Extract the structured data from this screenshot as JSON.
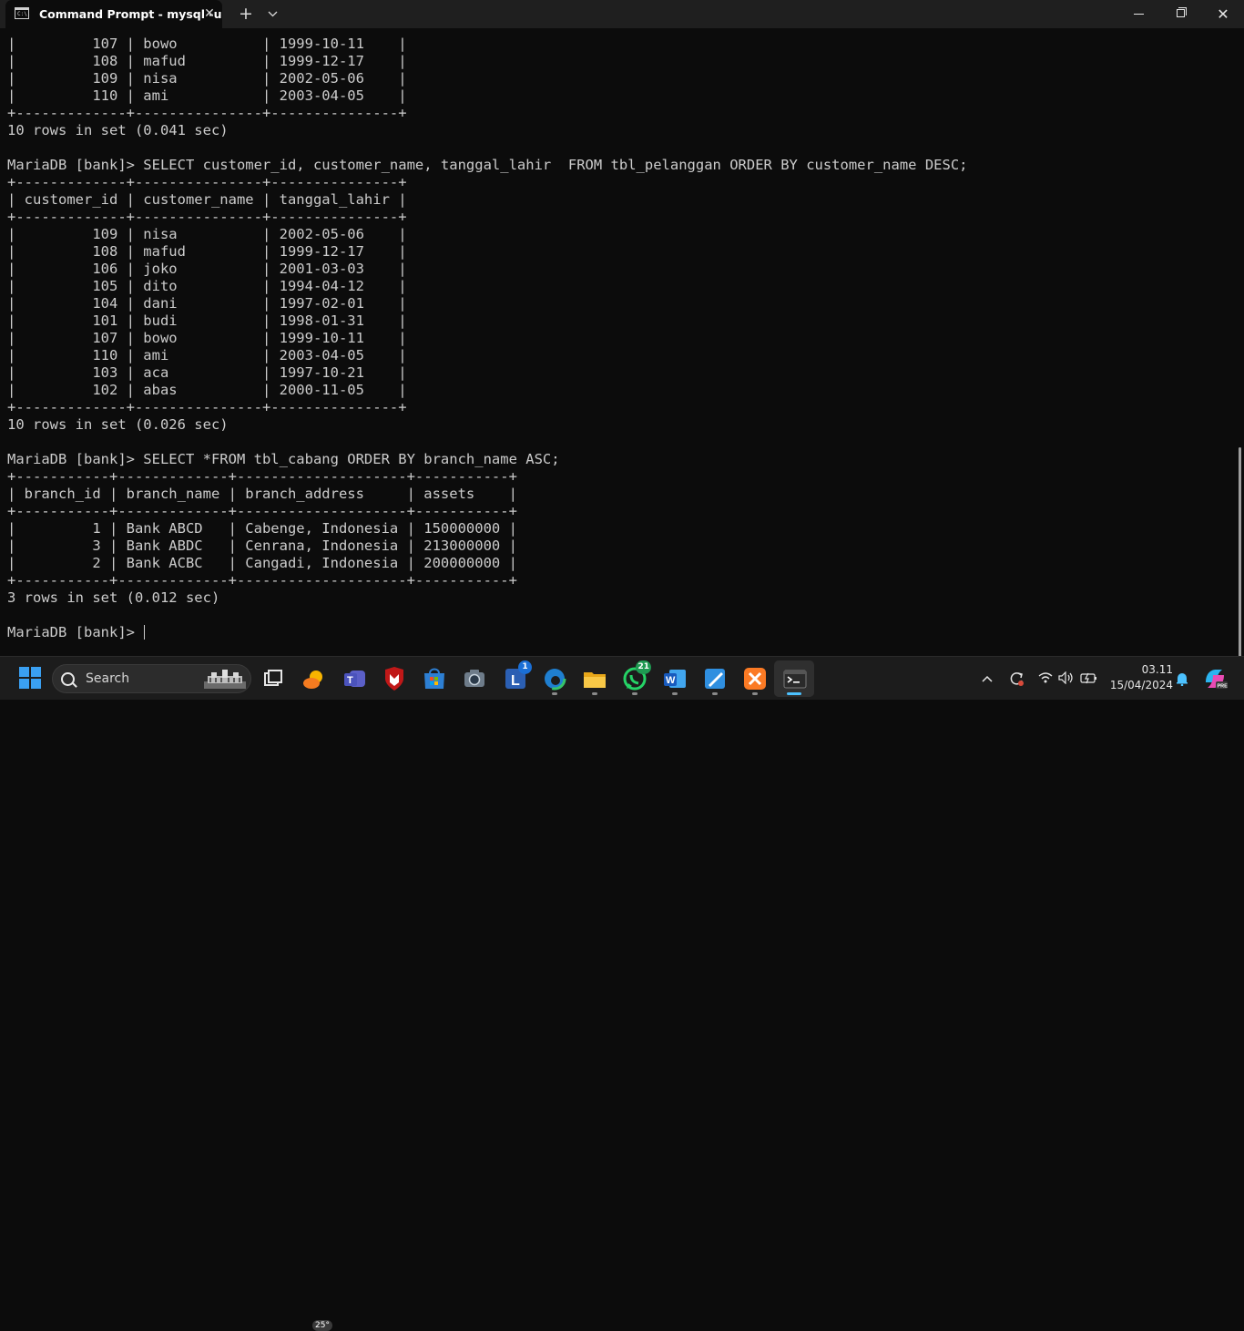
{
  "window": {
    "tab_title": "Command Prompt - mysql  -u",
    "tab_icon_text": "C:\\.",
    "close_tab_label": "✕",
    "new_tab_label": "+",
    "dropdown_label": "⌄",
    "minimize_label": "",
    "maximize_label": "",
    "close_label": "✕"
  },
  "console": {
    "lines": [
      "|         107 | bowo          | 1999-10-11    |",
      "|         108 | mafud         | 1999-12-17    |",
      "|         109 | nisa          | 2002-05-06    |",
      "|         110 | ami           | 2003-04-05    |",
      "+-------------+---------------+---------------+",
      "10 rows in set (0.041 sec)",
      "",
      "MariaDB [bank]> SELECT customer_id, customer_name, tanggal_lahir  FROM tbl_pelanggan ORDER BY customer_name DESC;",
      "+-------------+---------------+---------------+",
      "| customer_id | customer_name | tanggal_lahir |",
      "+-------------+---------------+---------------+",
      "|         109 | nisa          | 2002-05-06    |",
      "|         108 | mafud         | 1999-12-17    |",
      "|         106 | joko          | 2001-03-03    |",
      "|         105 | dito          | 1994-04-12    |",
      "|         104 | dani          | 1997-02-01    |",
      "|         101 | budi          | 1998-01-31    |",
      "|         107 | bowo          | 1999-10-11    |",
      "|         110 | ami           | 2003-04-05    |",
      "|         103 | aca           | 1997-10-21    |",
      "|         102 | abas          | 2000-11-05    |",
      "+-------------+---------------+---------------+",
      "10 rows in set (0.026 sec)",
      "",
      "MariaDB [bank]> SELECT *FROM tbl_cabang ORDER BY branch_name ASC;",
      "+-----------+-------------+--------------------+-----------+",
      "| branch_id | branch_name | branch_address     | assets    |",
      "+-----------+-------------+--------------------+-----------+",
      "|         1 | Bank ABCD   | Cabenge, Indonesia | 150000000 |",
      "|         3 | Bank ABDC   | Cenrana, Indonesia | 213000000 |",
      "|         2 | Bank ACBC   | Cangadi, Indonesia | 200000000 |",
      "+-----------+-------------+--------------------+-----------+",
      "3 rows in set (0.012 sec)",
      "",
      "MariaDB [bank]> "
    ]
  },
  "taskbar": {
    "search_label": "Search",
    "weather_temp": "25°",
    "apps": [
      {
        "name": "task-view-icon",
        "badge": ""
      },
      {
        "name": "weather-widget-icon",
        "badge": ""
      },
      {
        "name": "teams-icon",
        "badge": ""
      },
      {
        "name": "mcafee-icon",
        "badge": ""
      },
      {
        "name": "microsoft-store-icon",
        "badge": ""
      },
      {
        "name": "camera-icon",
        "badge": ""
      },
      {
        "name": "l-app-icon",
        "badge": "1"
      },
      {
        "name": "edge-icon",
        "badge": ""
      },
      {
        "name": "file-explorer-icon",
        "badge": ""
      },
      {
        "name": "whatsapp-icon",
        "badge": "21"
      },
      {
        "name": "word-icon",
        "badge": ""
      },
      {
        "name": "paint-icon",
        "badge": ""
      },
      {
        "name": "xampp-icon",
        "badge": ""
      },
      {
        "name": "terminal-icon",
        "badge": ""
      }
    ],
    "tray": {
      "chevron": "^",
      "sync": "⟳",
      "wifi": "",
      "volume": "🔈",
      "battery": ""
    },
    "clock": {
      "time": "03.11",
      "date": "15/04/2024"
    }
  },
  "colors": {
    "console_bg": "#0c0c0c",
    "console_fg": "#cccccc",
    "taskbar_bg": "#1c1c1c",
    "accent": "#4cc2ff"
  }
}
